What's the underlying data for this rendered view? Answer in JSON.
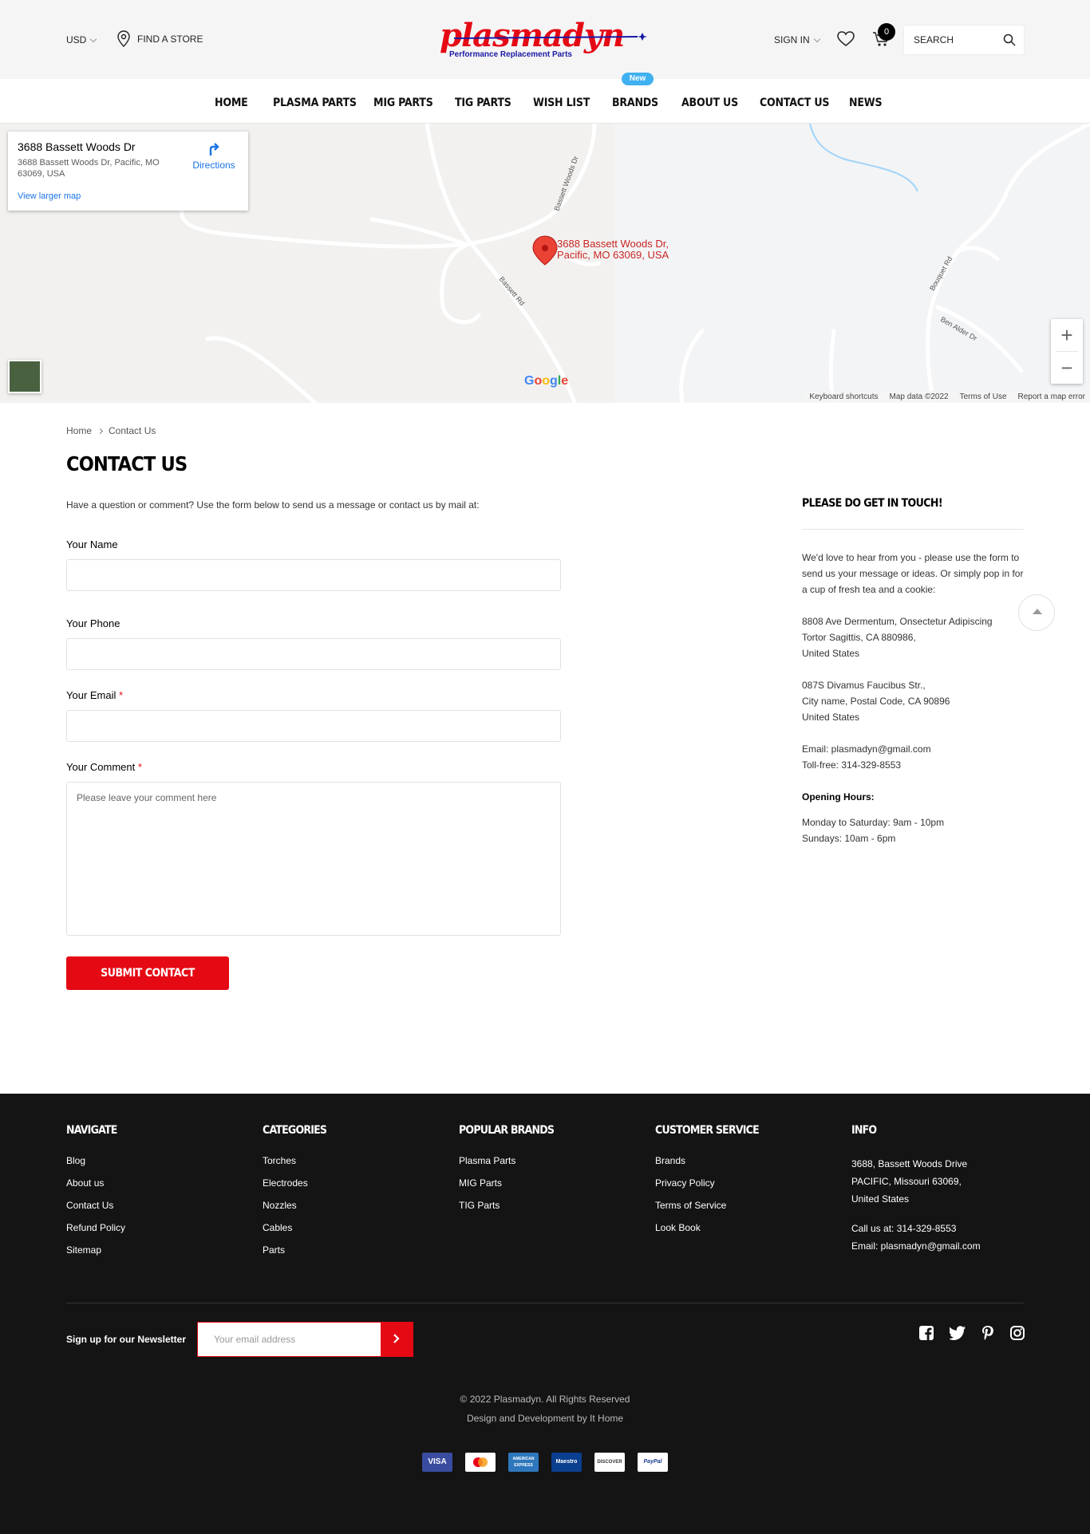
{
  "header": {
    "currency": "USD",
    "find_store": "FIND A STORE",
    "logo_text": "plasmadyn",
    "logo_tagline": "Performance Replacement Parts",
    "sign_in": "SIGN IN",
    "cart_count": "0",
    "search_placeholder": "SEARCH"
  },
  "nav": {
    "items": [
      "HOME",
      "PLASMA PARTS",
      "MIG PARTS",
      "TIG PARTS",
      "WISH LIST",
      "BRANDS",
      "ABOUT US",
      "CONTACT US",
      "NEWS"
    ],
    "new_badge": "New"
  },
  "map": {
    "card_title": "3688 Bassett Woods Dr",
    "card_address": "3688 Bassett Woods Dr, Pacific, MO 63069, USA",
    "directions": "Directions",
    "view_larger": "View larger map",
    "pin_label_1": "3688 Bassett Woods Dr,",
    "pin_label_2": "Pacific, MO 63069, USA",
    "road_labels": [
      "Bassett Woods Dr",
      "Bassett Rd",
      "Bouquet Rd",
      "Ben Alder Dr"
    ],
    "google": "Google",
    "footer": [
      "Keyboard shortcuts",
      "Map data ©2022",
      "Terms of Use",
      "Report a map error"
    ]
  },
  "breadcrumb": [
    "Home",
    "Contact Us"
  ],
  "page_title": "CONTACT US",
  "intro": "Have a question or comment? Use the form below to send us a message or contact us by mail at:",
  "form": {
    "name_label": "Your Name",
    "phone_label": "Your Phone",
    "email_label": "Your Email",
    "comment_label": "Your Comment",
    "required_mark": "*",
    "comment_placeholder": "Please leave your comment here",
    "submit": "SUBMIT CONTACT"
  },
  "sidebar": {
    "title": "PLEASE DO GET IN TOUCH!",
    "intro": "We'd love to hear from you - please use the form to send us your message or ideas. Or simply pop in for a cup of fresh tea and a cookie:",
    "address1": [
      "8808 Ave Dermentum, Onsectetur Adipiscing",
      "Tortor Sagittis, CA 880986,",
      "United States"
    ],
    "address2": [
      "087S Divamus Faucibus Str.,",
      "City name, Postal Code, CA 90896",
      "United States"
    ],
    "email": "Email: plasmadyn@gmail.com",
    "tollfree": "Toll-free: 314-329-8553",
    "hours_title": "Opening Hours:",
    "hours": [
      "Monday to Saturday: 9am - 10pm",
      "Sundays: 10am - 6pm"
    ]
  },
  "footer": {
    "navigate": {
      "title": "NAVIGATE",
      "links": [
        "Blog",
        "About us",
        "Contact Us",
        "Refund Policy",
        "Sitemap"
      ]
    },
    "categories": {
      "title": "CATEGORIES",
      "links": [
        "Torches",
        "Electrodes",
        "Nozzles",
        "Cables",
        "Parts"
      ]
    },
    "brands": {
      "title": "POPULAR BRANDS",
      "links": [
        "Plasma Parts",
        "MIG Parts",
        "TIG Parts"
      ]
    },
    "service": {
      "title": "CUSTOMER SERVICE",
      "links": [
        "Brands",
        "Privacy Policy",
        "Terms of Service",
        "Look Book"
      ]
    },
    "info": {
      "title": "INFO",
      "address": [
        "3688, Bassett Woods Drive",
        "PACIFIC, Missouri 63069,",
        "United States"
      ],
      "call": "Call us at: 314-329-8553",
      "email": "Email: plasmadyn@gmail.com"
    },
    "newsletter_label": "Sign up for our Newsletter",
    "newsletter_placeholder": "Your email address",
    "social": [
      "facebook-icon",
      "twitter-icon",
      "pinterest-icon",
      "instagram-icon"
    ],
    "copyright": "© 2022 Plasmadyn. All Rights Reserved",
    "credit": "Design and Development by It Home",
    "payments": [
      "VISA",
      "MasterCard",
      "AMERICAN EXPRESS",
      "Maestro",
      "DISCOVER",
      "PayPal"
    ]
  },
  "colors": {
    "accent": "#e50914",
    "footer_bg": "#141414",
    "badge": "#3fb0f0",
    "link_blue": "#1a73e8"
  }
}
